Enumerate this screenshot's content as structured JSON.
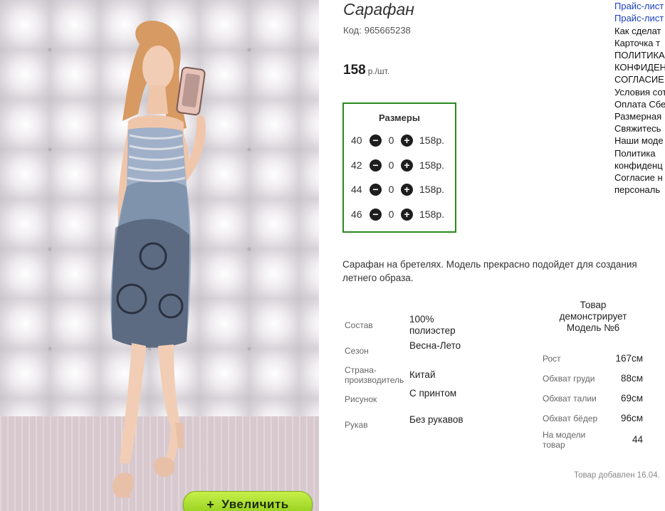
{
  "product": {
    "title": "Сарафан",
    "code_label": "Код:",
    "code_value": "965665238",
    "price_value": "158",
    "price_unit": "р./шт.",
    "zoom_button": "Увеличить",
    "zoom_icon": "+"
  },
  "sizes": {
    "title": "Размеры",
    "items": [
      {
        "size": "40",
        "qty": "0",
        "price": "158р."
      },
      {
        "size": "42",
        "qty": "0",
        "price": "158р."
      },
      {
        "size": "44",
        "qty": "0",
        "price": "158р."
      },
      {
        "size": "46",
        "qty": "0",
        "price": "158р."
      }
    ],
    "minus_icon": "minus-circle-icon",
    "plus_icon": "plus-circle-icon"
  },
  "description": "Сарафан на бретелях. Модель прекрасно подойдет для создания летнего образа.",
  "specs": [
    {
      "label": "Состав",
      "value": "100% полиэстер"
    },
    {
      "label": "Сезон",
      "value": "Весна-Лето"
    },
    {
      "label": "Страна-производитель",
      "value": "Китай"
    },
    {
      "label": "Рисунок",
      "value": "С принтом"
    },
    {
      "label": "Рукав",
      "value": "Без рукавов"
    }
  ],
  "model": {
    "header": "Товар демонстрирует Модель №6",
    "params": [
      {
        "label": "Рост",
        "value": "167см"
      },
      {
        "label": "Обхват груди",
        "value": "88см"
      },
      {
        "label": "Обхват талии",
        "value": "69см"
      },
      {
        "label": "Обхват бёдер",
        "value": "96см"
      },
      {
        "label": "На модели товар",
        "value": "44"
      }
    ]
  },
  "added_text": "Товар добавлен 16.04.",
  "sidebar": {
    "items": [
      {
        "text": "Прайс-лист",
        "link": true
      },
      {
        "text": "Прайс-лист",
        "link": true
      },
      {
        "text": "Как сделат",
        "link": false
      },
      {
        "text": "Карточка т",
        "link": false
      },
      {
        "text": "ПОЛИТИКА",
        "link": false
      },
      {
        "text": "КОНФИДЕН",
        "link": false
      },
      {
        "text": "СОГЛАСИЕ",
        "link": false
      },
      {
        "text": "Условия сот",
        "link": false
      },
      {
        "text": "Оплата Сбе",
        "link": false
      },
      {
        "text": "Размерная",
        "link": false
      },
      {
        "text": "Свяжитесь",
        "link": false
      },
      {
        "text": "Наши моде",
        "link": false
      },
      {
        "text": "Политика",
        "link": false
      },
      {
        "text": "конфиденц",
        "link": false
      },
      {
        "text": "Согласие н",
        "link": false
      },
      {
        "text": "персональ",
        "link": false
      }
    ]
  },
  "colors": {
    "sizes_border": "#2b8a1e",
    "zoom_button": "#a6dd2a",
    "link": "#1a3fbf"
  }
}
